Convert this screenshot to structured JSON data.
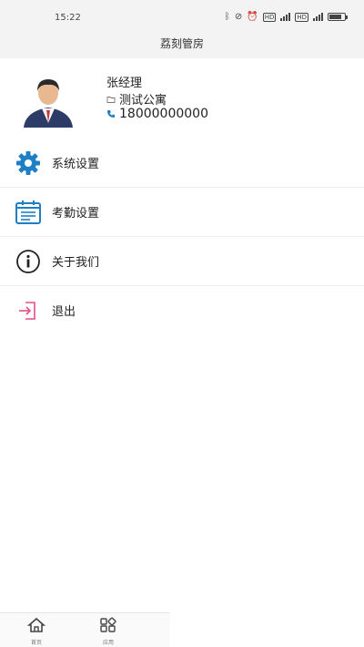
{
  "status_bar": {
    "time": "15:22"
  },
  "header": {
    "title": "荔刻管房"
  },
  "profile": {
    "name": "张经理",
    "apartment": "测试公寓",
    "phone": "18000000000"
  },
  "menu": {
    "items": [
      {
        "label": "系统设置",
        "icon": "gear-icon"
      },
      {
        "label": "考勤设置",
        "icon": "attendance-calendar-icon"
      },
      {
        "label": "关于我们",
        "icon": "info-icon"
      },
      {
        "label": "退出",
        "icon": "logout-icon"
      }
    ]
  },
  "tabbar": {
    "home_label": "首页",
    "apps_label": "应用"
  },
  "colors": {
    "accent_blue": "#1f7fc4",
    "logout_pink": "#e0508a",
    "header_bg": "#f3f3f3"
  }
}
